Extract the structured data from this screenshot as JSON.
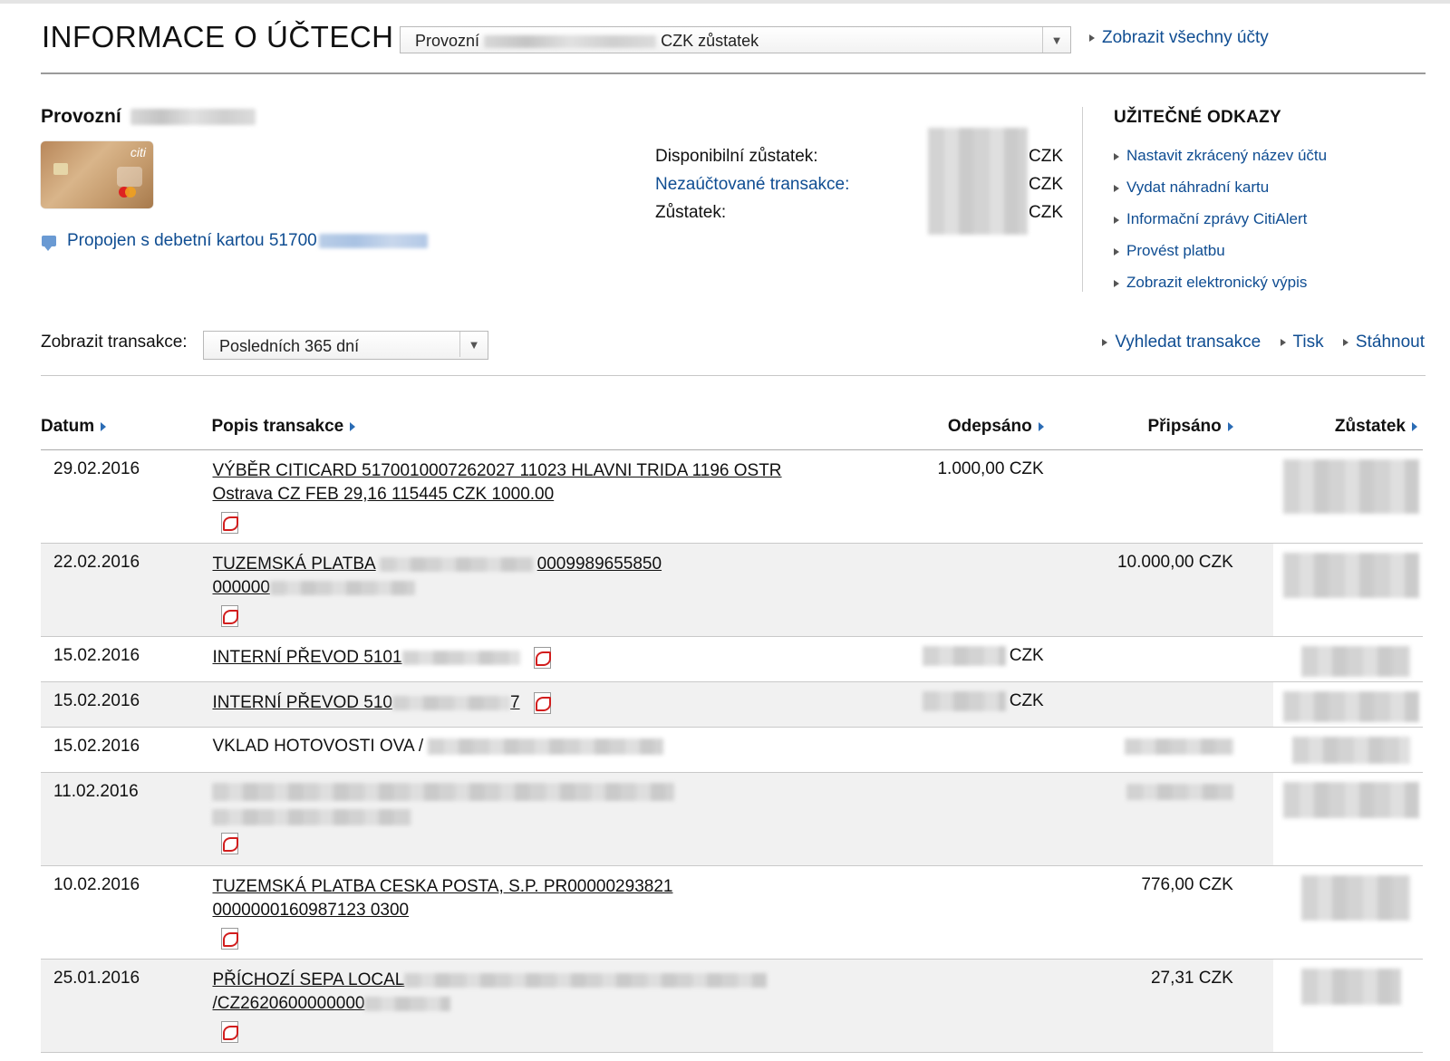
{
  "header": {
    "title": "INFORMACE O ÚČTECH",
    "account_select_prefix": "Provozní",
    "account_select_suffix": "CZK zůstatek",
    "show_all": "Zobrazit všechny účty"
  },
  "account": {
    "name": "Provozní",
    "card_logo": "citi",
    "linked_prefix": "Propojen s debetní kartou 51700",
    "balances": [
      {
        "label": "Disponibilní zůstatek:",
        "is_link": false,
        "currency": "CZK"
      },
      {
        "label": "Nezaúčtované transakce:",
        "is_link": true,
        "currency": "CZK"
      },
      {
        "label": "Zůstatek:",
        "is_link": false,
        "currency": "CZK"
      }
    ]
  },
  "useful_links": {
    "title": "UŽITEČNÉ ODKAZY",
    "items": [
      "Nastavit zkrácený název účtu",
      "Vydat náhradní kartu",
      "Informační zprávy CitiAlert",
      "Provést platbu",
      "Zobrazit elektronický výpis"
    ]
  },
  "filter": {
    "label": "Zobrazit transakce:",
    "selected": "Posledních 365 dní",
    "tools": [
      "Vyhledat transakce",
      "Tisk",
      "Stáhnout"
    ]
  },
  "table": {
    "columns": [
      "Datum",
      "Popis transakce",
      "Odepsáno",
      "Připsáno",
      "Zůstatek"
    ],
    "rows": [
      {
        "date": "29.02.2016",
        "desc1": "VÝBĚR CITICARD 5170010007262027 11023 HLAVNI TRIDA 1196 OSTR",
        "desc2": "Ostrava CZ FEB 29,16 115445 CZK 1000.00",
        "debit": "1.000,00 CZK",
        "credit": ""
      },
      {
        "date": "22.02.2016",
        "desc1": "TUZEMSKÁ PLATBA",
        "desc1_tail": "0009989655850",
        "desc2": "000000",
        "debit": "",
        "credit": "10.000,00 CZK"
      },
      {
        "date": "15.02.2016",
        "desc1": "INTERNÍ PŘEVOD 5101",
        "debit_cur": "CZK"
      },
      {
        "date": "15.02.2016",
        "desc1": "INTERNÍ PŘEVOD 510",
        "desc1_tail": "7",
        "debit_cur": "CZK"
      },
      {
        "date": "15.02.2016",
        "desc1": "VKLAD HOTOVOSTI OVA /"
      },
      {
        "date": "11.02.2016"
      },
      {
        "date": "10.02.2016",
        "desc1": "TUZEMSKÁ PLATBA CESKA POSTA, S.P. PR00000293821",
        "desc2": "0000000160987123 0300",
        "debit": "",
        "credit": "776,00 CZK"
      },
      {
        "date": "25.01.2016",
        "desc1": "PŘÍCHOZÍ SEPA LOCAL",
        "desc2": "/CZ2620600000000",
        "debit": "",
        "credit": "27,31 CZK"
      }
    ]
  },
  "colors": {
    "link": "#0f4d92",
    "row_alt": "#f1f1f1",
    "pdf_red": "#d21d1d"
  },
  "icons": [
    "dropdown-arrow-icon",
    "link-arrow-icon",
    "chat-bubble-icon",
    "sort-arrow-icon",
    "pdf-icon",
    "credit-card-image"
  ]
}
